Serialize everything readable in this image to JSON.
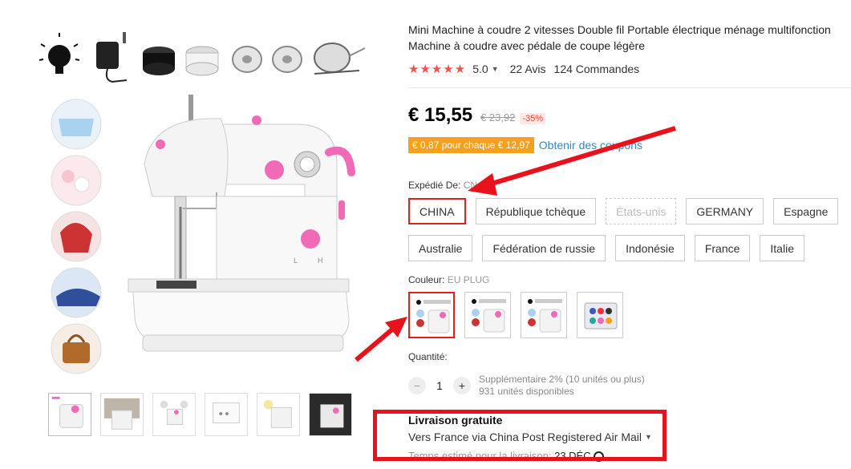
{
  "product": {
    "title": "Mini Machine à coudre 2 vitesses Double fil Portable électrique ménage multifonction Machine à coudre avec pédale de coupe légère",
    "stars": "★★★★★",
    "rating": "5.0",
    "reviews": "22 Avis",
    "orders": "124 Commandes"
  },
  "price": {
    "current": "€ 15,55",
    "original": "€ 23,92",
    "discount": "-35%"
  },
  "coupon": {
    "badge": "€ 0,87 pour chaque € 12,97",
    "link": "Obtenir des coupons"
  },
  "shipping_from": {
    "label": "Expédié De:",
    "selected_value": "CN",
    "options": [
      {
        "label": "CHINA",
        "state": "selected"
      },
      {
        "label": "République tchèque",
        "state": "normal"
      },
      {
        "label": "États-unis",
        "state": "disabled"
      },
      {
        "label": "GERMANY",
        "state": "normal"
      },
      {
        "label": "Espagne",
        "state": "normal"
      },
      {
        "label": "Australie",
        "state": "normal"
      },
      {
        "label": "Fédération de russie",
        "state": "normal"
      },
      {
        "label": "Indonésie",
        "state": "normal"
      },
      {
        "label": "France",
        "state": "normal"
      },
      {
        "label": "Italie",
        "state": "normal"
      }
    ]
  },
  "color": {
    "label": "Couleur:",
    "value": "EU PLUG",
    "swatches": [
      "machine-1",
      "machine-2",
      "machine-3",
      "bobbin-box"
    ]
  },
  "quantity": {
    "label": "Quantité:",
    "value": "1",
    "minus": "−",
    "plus": "+",
    "note_line1": "Supplémentaire 2% (10 unités ou plus)",
    "note_line2": "931 unités disponibles"
  },
  "delivery": {
    "title": "Livraison gratuite",
    "route": "Vers France via China Post Registered Air Mail",
    "estimate_prefix": "Temps estimé pour la livraison:",
    "estimate_value": "23 DÉC"
  },
  "colors": {
    "accent_red": "#e02020",
    "star_red": "#f05252",
    "coupon_orange": "#f8a01b",
    "link_blue": "#2e87c8",
    "pink": "#f06ab6"
  }
}
